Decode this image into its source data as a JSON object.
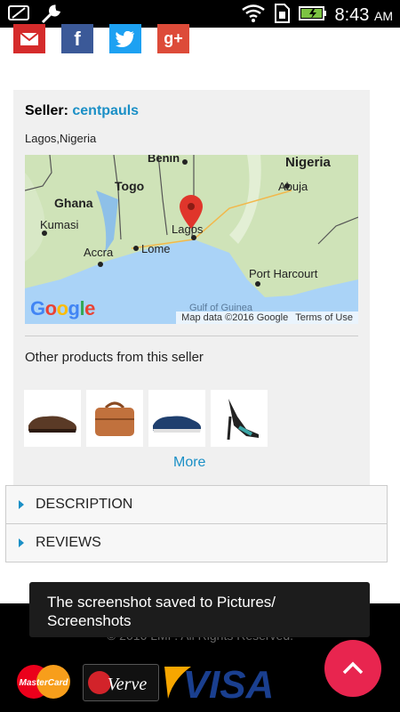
{
  "status_bar": {
    "time": "8:43",
    "ampm": "AM"
  },
  "share": [
    {
      "icon": "email-icon"
    },
    {
      "icon": "facebook-icon",
      "label": "f"
    },
    {
      "icon": "twitter-icon"
    },
    {
      "icon": "google-plus-icon",
      "label": "g+"
    }
  ],
  "seller": {
    "label": "Seller",
    "colon": ":",
    "name": "centpauls",
    "location": "Lagos,Nigeria"
  },
  "map": {
    "labels": [
      "Benin",
      "Nigeria",
      "Togo",
      "Abuja",
      "Ghana",
      "Kumasi",
      "Lagos",
      "Accra",
      "Lome",
      "Port Harcourt",
      "Gulf of Guinea"
    ],
    "google_logo": "Google",
    "attribution": "Map data ©2016 Google",
    "terms": "Terms of Use"
  },
  "other_products": {
    "title": "Other products from this seller",
    "more_label": "More"
  },
  "accordion": {
    "description": "DESCRIPTION",
    "reviews": "REVIEWS"
  },
  "footer": {
    "copyright": "© 2016 LMP. All Rights Reserved.",
    "payment": {
      "mastercard": "MasterCard",
      "verve": "Verve",
      "visa": "VISA"
    }
  },
  "toast": {
    "message": "The screenshot saved to Pictures/\nScreenshots"
  },
  "colors": {
    "accent": "#1a8fc6",
    "fab": "#e8254f",
    "email": "#d52b2b",
    "facebook": "#3b5998",
    "twitter": "#1da1f2",
    "googleplus": "#dd4b39"
  }
}
